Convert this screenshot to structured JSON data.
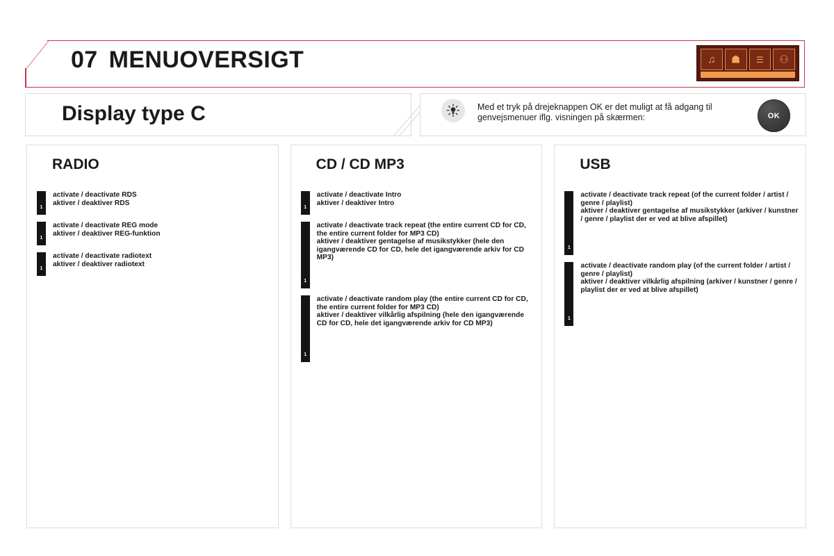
{
  "header": {
    "chapter_number": "07",
    "chapter_title": "MENUOVERSIGT",
    "accent_color": "#c8324b",
    "chapter_icon": {
      "name": "chapter-illustration",
      "background": "#55190c",
      "shelf_color": "#f09a4e",
      "cells": [
        {
          "name": "audio-icon",
          "glyph": "♫"
        },
        {
          "name": "drink-icon",
          "glyph": "☗"
        },
        {
          "name": "controls-icon",
          "glyph": "☰"
        },
        {
          "name": "radio-icon",
          "glyph": "⚇"
        }
      ]
    }
  },
  "info_strip": {
    "display_title": "Display type C",
    "bulb_icon": "light-bulb-icon",
    "note_text": "Med et tryk på drejeknappen OK er det muligt at få adgang til genvejsmenuer iflg. visningen på skærmen:",
    "ok_button_label": "OK",
    "ok_button_color": "#3d3d3d"
  },
  "columns": [
    {
      "id": "radio",
      "title": "RADIO",
      "entries": [
        {
          "marker_label": "1",
          "marker_height": 34,
          "en": "activate / deactivate RDS",
          "da": "aktiver / deaktiver RDS"
        },
        {
          "marker_label": "1",
          "marker_height": 34,
          "en": "activate / deactivate REG mode",
          "da": "aktiver / deaktiver REG-funktion"
        },
        {
          "marker_label": "1",
          "marker_height": 34,
          "en": "activate / deactivate radiotext",
          "da": "aktiver / deaktiver radiotext"
        }
      ]
    },
    {
      "id": "cd",
      "title": "CD / CD MP3",
      "entries": [
        {
          "marker_label": "1",
          "marker_height": 34,
          "en": "activate / deactivate Intro",
          "da": "aktiver / deaktiver Intro"
        },
        {
          "marker_label": "1",
          "marker_height": 96,
          "en": "activate / deactivate track repeat (the entire current CD for CD, the entire current folder for MP3 CD)",
          "da": "aktiver / deaktiver gentagelse af musikstykker (hele den igangværende CD for CD, hele det igangværende arkiv for CD MP3)"
        },
        {
          "marker_label": "1",
          "marker_height": 96,
          "en": "activate / deactivate random play (the entire current CD for CD, the entire current folder for MP3 CD)",
          "da": "aktiver / deaktiver vilkårlig afspilning (hele den igangværende CD for CD, hele det igangværende arkiv for CD MP3)"
        }
      ]
    },
    {
      "id": "usb",
      "title": "USB",
      "entries": [
        {
          "marker_label": "1",
          "marker_height": 92,
          "en": "activate / deactivate track repeat (of the current folder / artist / genre / playlist)",
          "da": "aktiver / deaktiver gentagelse af musikstykker (arkiver / kunstner / genre / playlist der er ved at blive afspillet)"
        },
        {
          "marker_label": "1",
          "marker_height": 92,
          "en": "activate / deactivate random play (of the current folder / artist / genre / playlist)",
          "da": "aktiver / deaktiver vilkårlig afspilning (arkiver / kunstner / genre / playlist der er ved at blive afspillet)"
        }
      ]
    }
  ]
}
